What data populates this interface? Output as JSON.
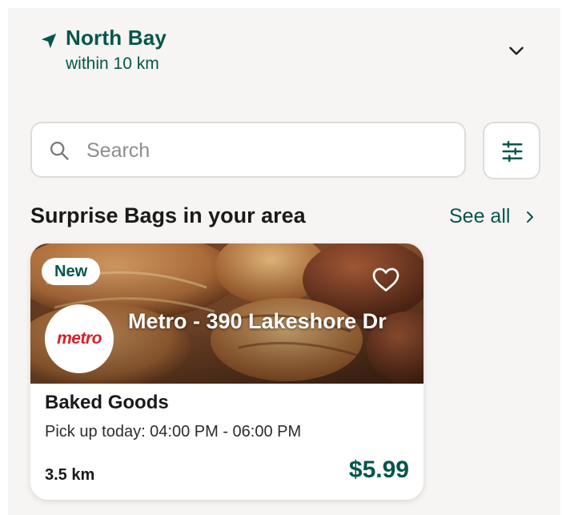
{
  "location": {
    "title": "North Bay",
    "subtitle": "within 10 km",
    "icon": "location-arrow-icon",
    "dropdown_icon": "chevron-down-icon"
  },
  "search": {
    "placeholder": "Search",
    "value": "",
    "icon": "search-icon",
    "filter_icon": "filter-sliders-icon"
  },
  "section": {
    "title": "Surprise Bags in your area",
    "see_all_label": "See all"
  },
  "card": {
    "badge": "New",
    "logo_text": "metro",
    "store_name": "Metro - 390 Lakeshore Dr",
    "bag_title": "Baked Goods",
    "pickup": "Pick up today: 04:00 PM - 06:00 PM",
    "distance": "3.5 km",
    "price": "$5.99",
    "favorite_icon": "heart-outline-icon"
  },
  "colors": {
    "brand": "#05564c",
    "background": "#f7f5f3",
    "logo_red": "#d5202a"
  }
}
